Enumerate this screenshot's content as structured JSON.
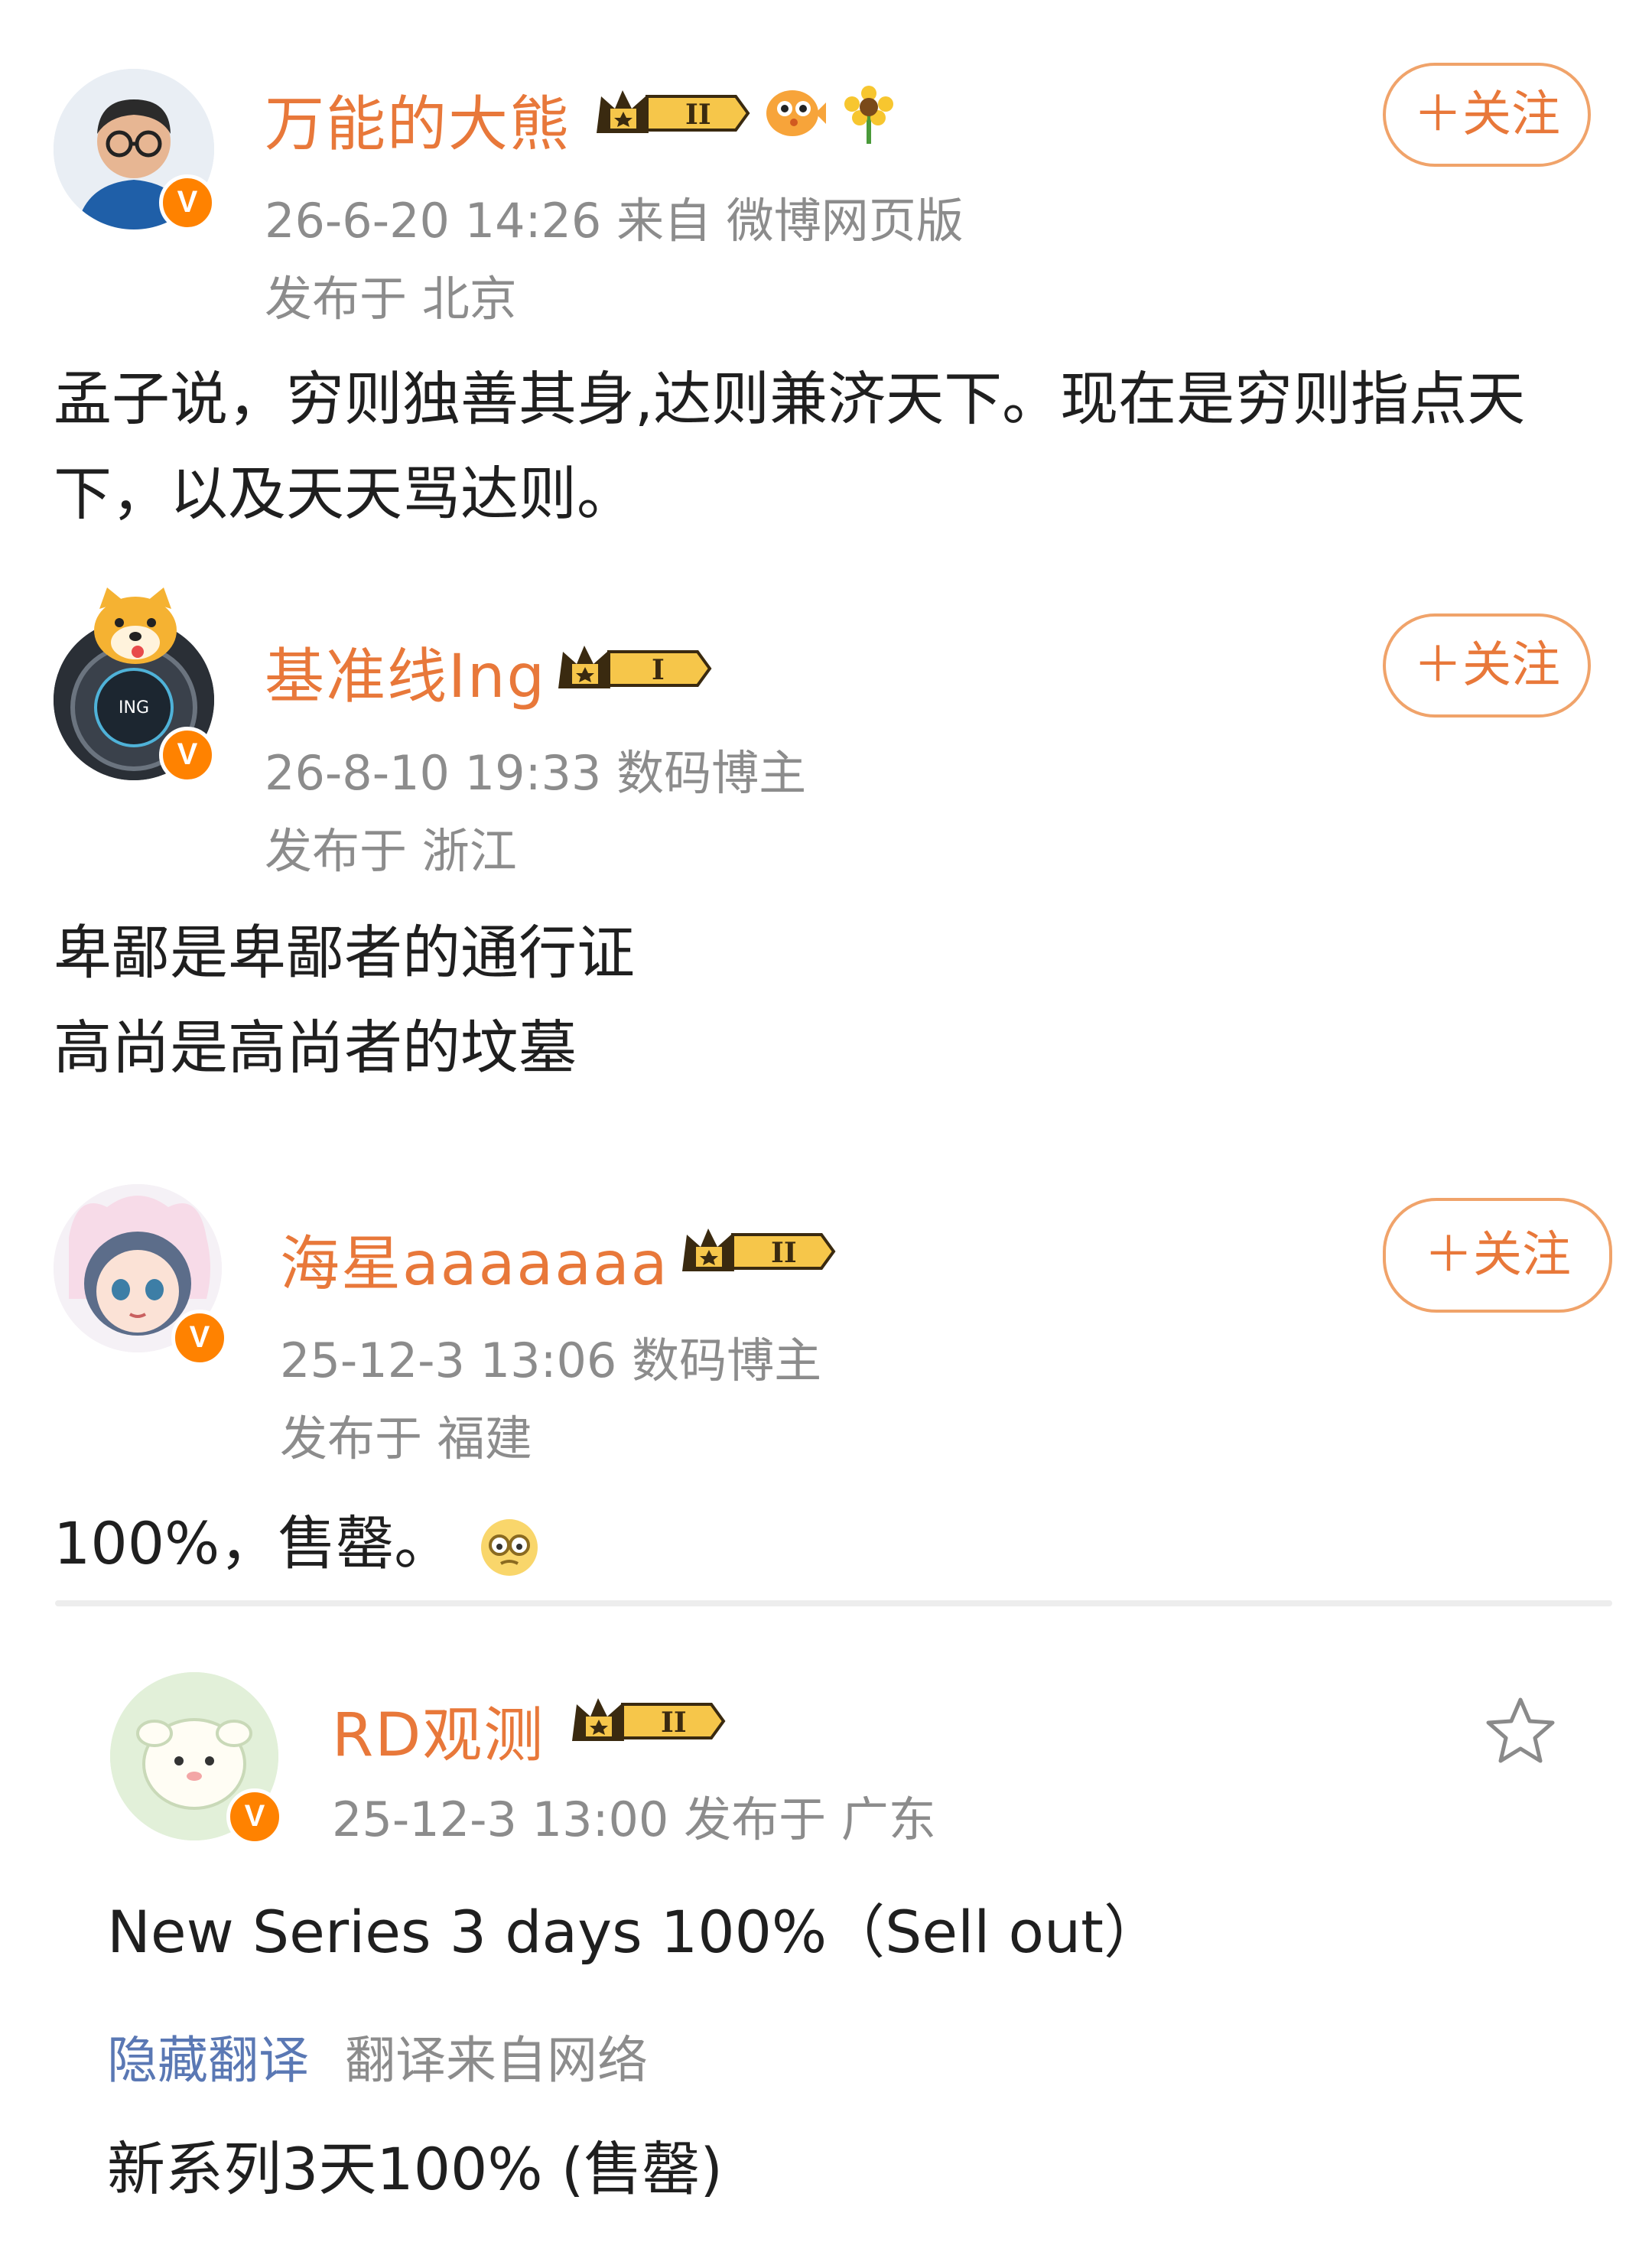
{
  "posts": [
    {
      "username": "万能的大熊",
      "level": "II",
      "meta": "26-6-20 14:26  来自 微博网页版",
      "location": "发布于 北京",
      "follow": "＋关注",
      "content": [
        "孟子说，穷则独善其身,达则兼济天下。现在是穷则指点天",
        "下，以及天天骂达则。"
      ]
    },
    {
      "username": "基准线Ing",
      "level": "I",
      "meta": "26-8-10 19:33  数码博主",
      "location": "发布于 浙江",
      "follow": "＋关注",
      "content": [
        "卑鄙是卑鄙者的通行证",
        "高尚是高尚者的坟墓"
      ]
    },
    {
      "username": "海星aaaaaaa",
      "level": "II",
      "meta": "25-12-3 13:06  数码博主",
      "location": "发布于 福建",
      "follow": "＋关注",
      "content": [
        "100%，售罄。"
      ]
    }
  ],
  "quoted": {
    "username": "RD观测",
    "level": "II",
    "meta": "25-12-3 13:00  发布于 广东",
    "content": "New Series 3 days 100%（Sell out）",
    "hide_translation": "隐藏翻译",
    "translation_source": "翻译来自网络",
    "translation": "新系列3天100% (售罄)"
  },
  "colors": {
    "accent": "#e8783a",
    "verified": "#ff8200",
    "link": "#5a78b4",
    "meta": "#8c8c8c"
  },
  "icons": [
    "verified-icon",
    "crown-level-icon",
    "puffer-fish-emoji-icon",
    "sunflower-emoji-icon",
    "awkward-emoji-icon",
    "star-icon"
  ]
}
